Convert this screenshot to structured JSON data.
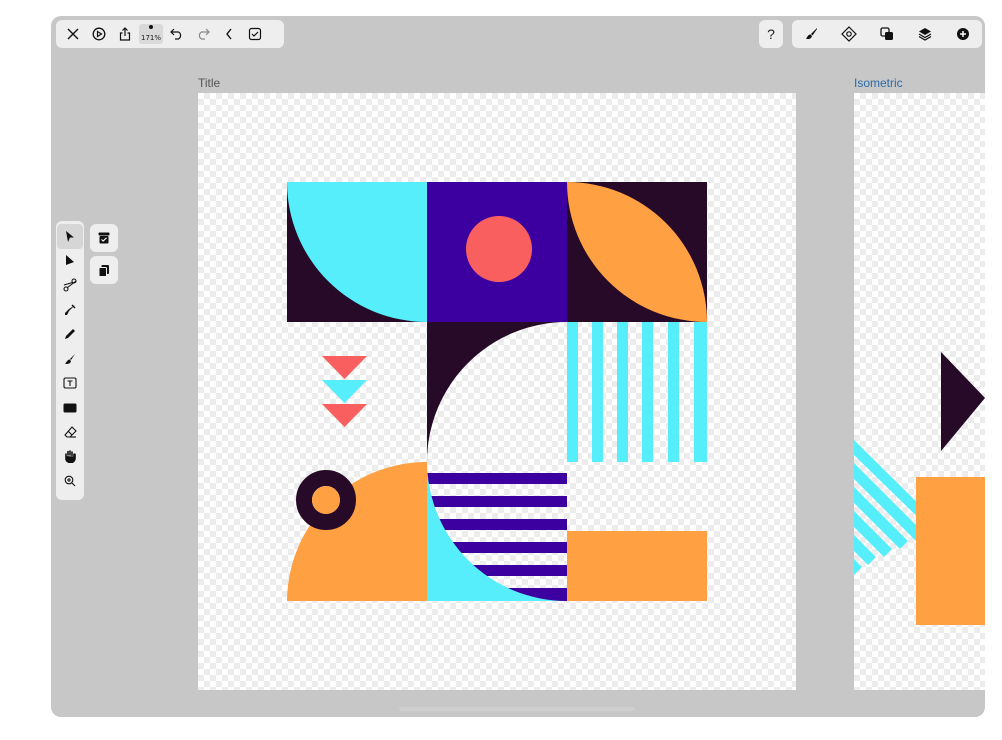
{
  "toolbar_top_left": {
    "items": [
      "close-icon",
      "play-icon",
      "share-icon",
      "zoom",
      "undo-icon",
      "redo-icon",
      "chevron-left-icon",
      "checkbox-icon"
    ],
    "zoom_label": "171%"
  },
  "toolbar_top_right": {
    "help_label": "?",
    "items": [
      "brush-settings-icon",
      "symbol-icon",
      "boolean-icon",
      "layers-icon",
      "add-circle-icon"
    ]
  },
  "tools": [
    "select-arrow-icon",
    "direct-select-icon",
    "scissors-icon",
    "pen-icon",
    "pencil-icon",
    "brush-icon",
    "text-icon",
    "rectangle-icon",
    "eraser-icon",
    "hand-icon",
    "zoom-in-icon"
  ],
  "side_buttons": [
    "archive-icon",
    "clipboard-icon"
  ],
  "artboards": {
    "first_title": "Title",
    "second_title": "Isometric"
  },
  "colors": {
    "cyan": "#55eefa",
    "indigo": "#3d00a0",
    "dark_plum": "#260a27",
    "orange": "#ffa042",
    "coral": "#fa5f60"
  }
}
